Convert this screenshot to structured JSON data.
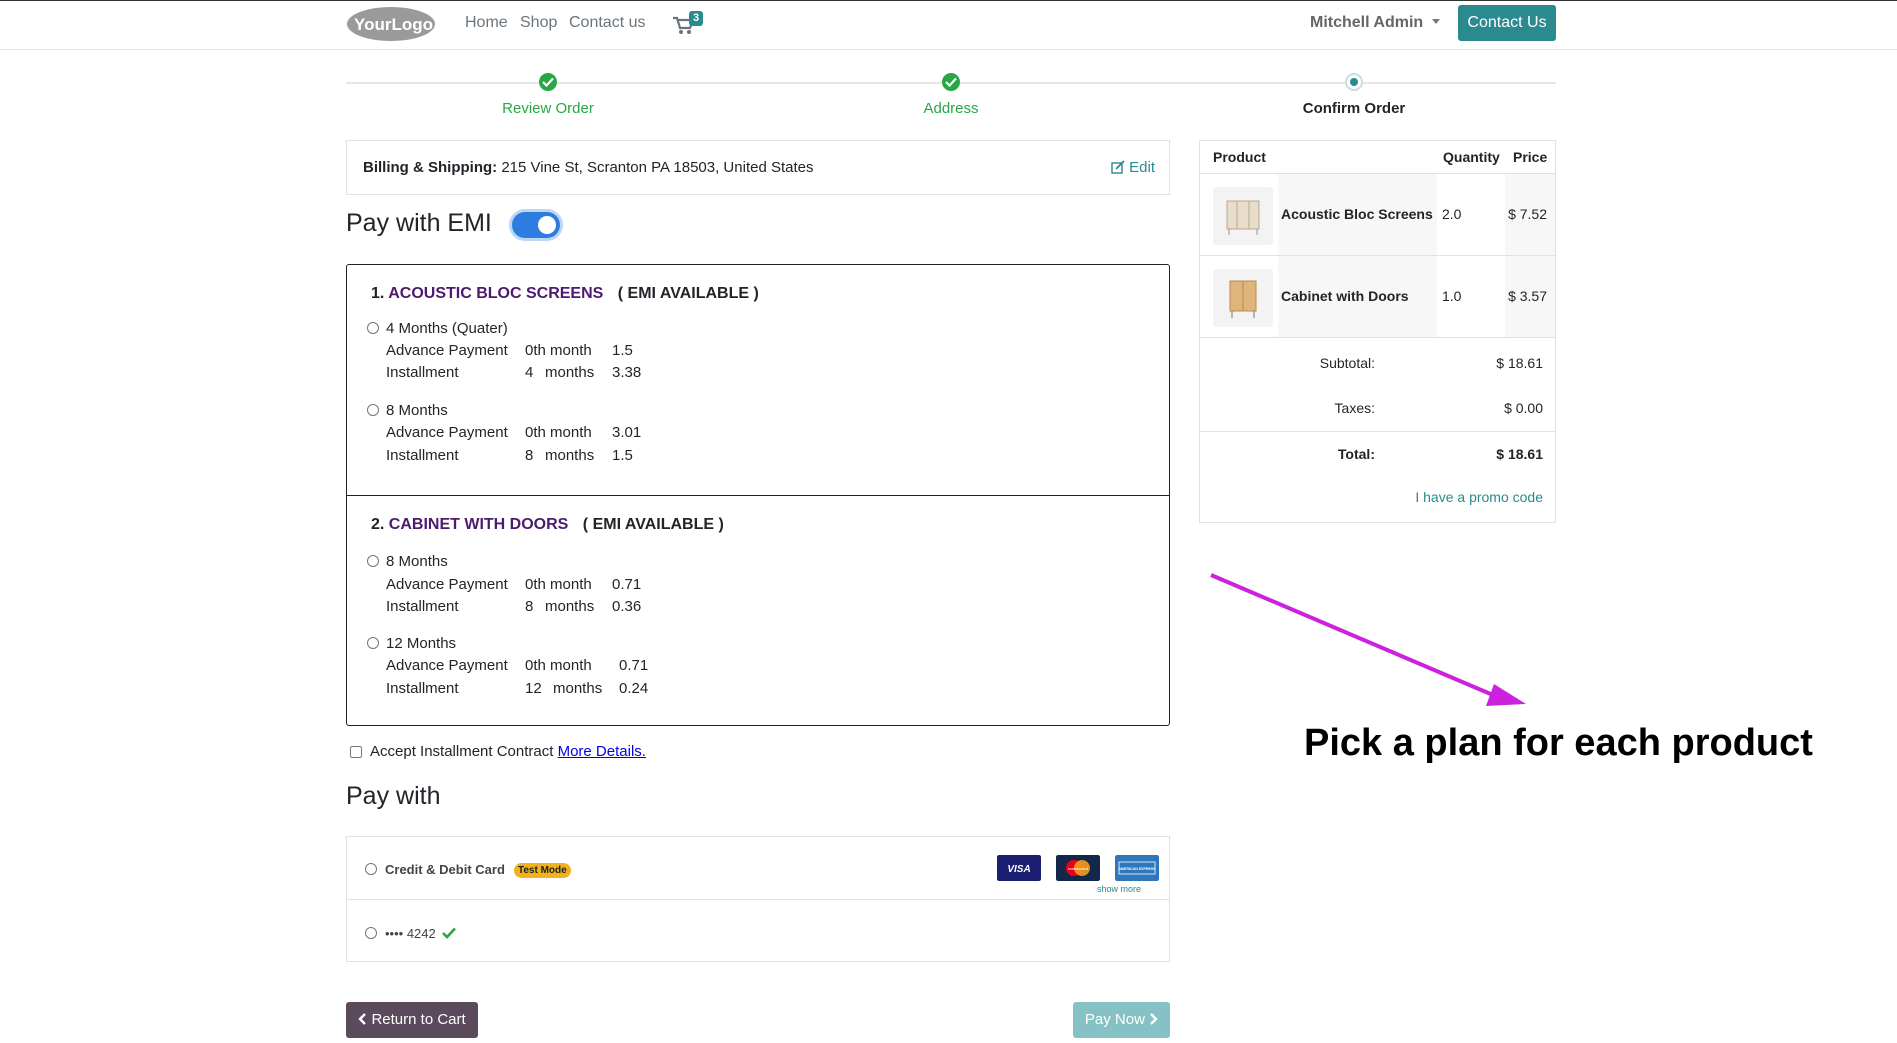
{
  "header": {
    "logo_text": "YourLogo",
    "nav": [
      "Home",
      "Shop",
      "Contact us"
    ],
    "cart_count": "3",
    "user_name": "Mitchell Admin",
    "contact_button": "Contact Us"
  },
  "wizard": {
    "steps": [
      {
        "label": "Review Order",
        "state": "done"
      },
      {
        "label": "Address",
        "state": "done"
      },
      {
        "label": "Confirm Order",
        "state": "current"
      }
    ]
  },
  "billing": {
    "label": "Billing & Shipping:",
    "address": "215 Vine St, Scranton PA 18503, United States",
    "edit_label": "Edit"
  },
  "emi": {
    "title": "Pay with EMI",
    "enabled": true,
    "products": [
      {
        "num": "1.",
        "name": "ACOUSTIC BLOC SCREENS",
        "availability": "( EMI AVAILABLE )",
        "plans": [
          {
            "title": "4 Months (Quater)",
            "advance_label": "Advance Payment",
            "advance_month": "0th month",
            "advance_value": "1.5",
            "install_label": "Installment",
            "install_count": "4",
            "install_unit": "months",
            "install_value": "3.38"
          },
          {
            "title": "8 Months",
            "advance_label": "Advance Payment",
            "advance_month": "0th month",
            "advance_value": "3.01",
            "install_label": "Installment",
            "install_count": "8",
            "install_unit": "months",
            "install_value": "1.5"
          }
        ]
      },
      {
        "num": "2.",
        "name": "CABINET WITH DOORS",
        "availability": "( EMI AVAILABLE )",
        "plans": [
          {
            "title": "8 Months",
            "advance_label": "Advance Payment",
            "advance_month": "0th month",
            "advance_value": "0.71",
            "install_label": "Installment",
            "install_count": "8",
            "install_unit": "months",
            "install_value": "0.36"
          },
          {
            "title": "12 Months",
            "advance_label": "Advance Payment",
            "advance_month": "0th month",
            "advance_value": "0.71",
            "install_label": "Installment",
            "install_count": "12",
            "install_unit": "months",
            "install_value": "0.24"
          }
        ]
      }
    ],
    "accept_label": "Accept Installment Contract",
    "more_details": "More Details."
  },
  "pay_with": {
    "title": "Pay with",
    "methods": [
      {
        "label": "Credit & Debit Card",
        "badge": "Test Mode"
      },
      {
        "label": "•••• 4242"
      }
    ],
    "card_icons": [
      "VISA",
      "mastercard",
      "AMERICAN EXPRESS"
    ],
    "show_more": "show more"
  },
  "buttons": {
    "return": "Return to Cart",
    "pay_now": "Pay Now"
  },
  "summary": {
    "headers": [
      "Product",
      "Quantity",
      "Price"
    ],
    "items": [
      {
        "name": "Acoustic Bloc Screens",
        "qty": "2.0",
        "price": "$ 7.52"
      },
      {
        "name": "Cabinet with Doors",
        "qty": "1.0",
        "price": "$ 3.57"
      }
    ],
    "subtotal_label": "Subtotal:",
    "subtotal": "$ 18.61",
    "taxes_label": "Taxes:",
    "taxes": "$ 0.00",
    "total_label": "Total:",
    "total": "$ 18.61",
    "promo": "I have a promo code"
  },
  "annotation": {
    "text": "Pick a plan for each product",
    "color": "#cc22dd"
  }
}
